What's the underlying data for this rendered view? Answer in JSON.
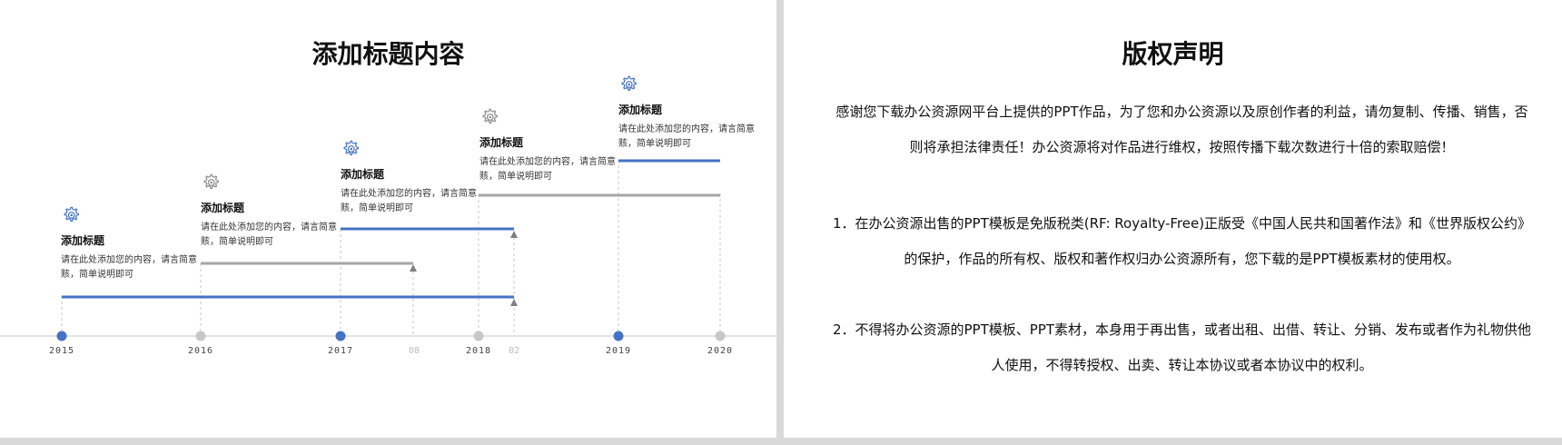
{
  "left": {
    "title": "添加标题内容",
    "cards": [
      {
        "title": "添加标题",
        "body": "请在此处添加您的内容，请言简意赅，简单说明即可",
        "icon": "gear-icon",
        "accent": "blue"
      },
      {
        "title": "添加标题",
        "body": "请在此处添加您的内容，请言简意赅，简单说明即可",
        "icon": "gear-icon",
        "accent": "gray"
      },
      {
        "title": "添加标题",
        "body": "请在此处添加您的内容，请言简意赅，简单说明即可",
        "icon": "gear-icon",
        "accent": "blue"
      },
      {
        "title": "添加标题",
        "body": "请在此处添加您的内容，请言简意赅，简单说明即可",
        "icon": "gear-icon",
        "accent": "gray"
      },
      {
        "title": "添加标题",
        "body": "请在此处添加您的内容，请言简意赅，简单说明即可",
        "icon": "gear-icon",
        "accent": "blue"
      }
    ],
    "years": [
      "2015",
      "2016",
      "2017",
      "2018",
      "2019",
      "2020"
    ],
    "months": [
      "08",
      "02"
    ]
  },
  "right": {
    "title": "版权声明",
    "intro": "感谢您下载办公资源网平台上提供的PPT作品，为了您和办公资源以及原创作者的利益，请勿复制、传播、销售，否则将承担法律责任！办公资源将对作品进行维权，按照传播下载次数进行十倍的索取赔偿！",
    "items": [
      "1．在办公资源出售的PPT模板是免版税类(RF: Royalty-Free)正版受《中国人民共和国著作法》和《世界版权公约》的保护，作品的所有权、版权和著作权归办公资源所有，您下载的是PPT模板素材的使用权。",
      "2．不得将办公资源的PPT模板、PPT素材，本身用于再出售，或者出租、出借、转让、分销、发布或者作为礼物供他人使用，不得转授权、出卖、转让本协议或者本协议中的权利。"
    ]
  },
  "colors": {
    "blue": "#4472c4",
    "gray": "#a6a6a6",
    "dot_gray": "#c8c8c8",
    "background": "#d9d9d9"
  }
}
